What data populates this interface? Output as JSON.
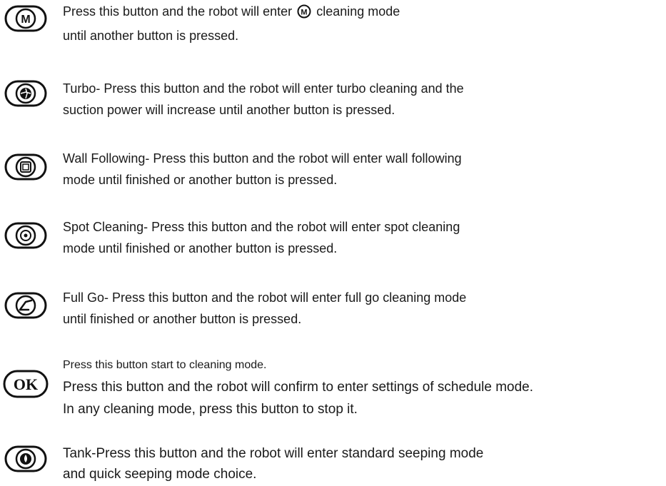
{
  "items": [
    {
      "icon": "m-mode-button-icon",
      "line1_before": "Press this button and the robot will enter",
      "line1_after": "cleaning mode",
      "line2": "until another button is pressed."
    },
    {
      "icon": "turbo-fan-button-icon",
      "line1": "Turbo- Press this button and the robot will enter turbo cleaning and the",
      "line2": "suction power will increase until another button is pressed."
    },
    {
      "icon": "wall-following-button-icon",
      "line1": "Wall Following- Press this button and the robot will enter wall following",
      "line2": "mode until finished or another button is pressed."
    },
    {
      "icon": "spot-cleaning-button-icon",
      "line1": "Spot Cleaning- Press this button and the robot will enter spot cleaning",
      "line2": "mode until finished or another button is pressed."
    },
    {
      "icon": "full-go-button-icon",
      "line1": "Full Go- Press this button and the robot will enter full go cleaning mode",
      "line2": "until finished or another button is pressed."
    },
    {
      "icon": "ok-button-icon",
      "icon_label": "OK",
      "line1": "Press this button start to cleaning mode.",
      "line2": "Press this button and the robot will confirm to enter settings of schedule mode.",
      "line3": "In any cleaning mode, press this button to stop it."
    },
    {
      "icon": "tank-button-icon",
      "line1": "Tank-Press this button and the robot will enter standard seeping mode",
      "line2": "and quick seeping mode choice."
    }
  ]
}
